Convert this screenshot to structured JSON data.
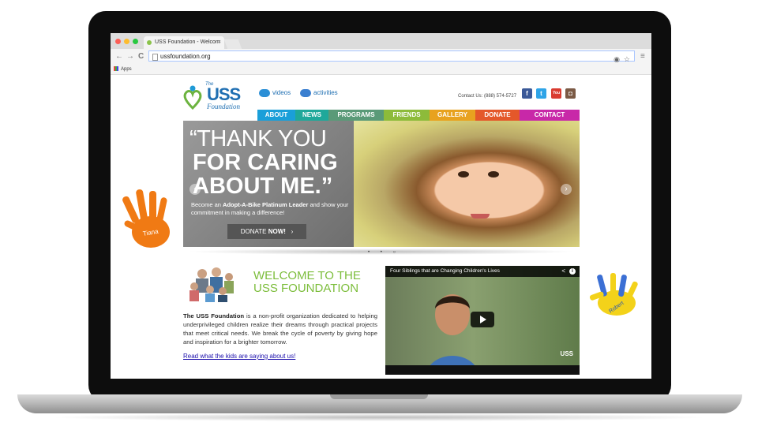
{
  "browser": {
    "tab_title": "USS Foundation - Welcom",
    "tab_close": "×",
    "url": "ussfoundation.org",
    "bookmarks_apps": "Apps",
    "back": "←",
    "forward": "→",
    "reload": "C",
    "menu": "≡"
  },
  "site": {
    "logo_the": "The",
    "logo_uss": "USS",
    "logo_foundation": "Foundation",
    "media_videos": "videos",
    "media_activities": "activities",
    "contact": "Contact Us: (888) 574-5727",
    "social": {
      "facebook": "f",
      "twitter": "t",
      "youtube": "You",
      "instagram": "◘"
    },
    "nav": [
      {
        "label": "ABOUT",
        "color": "#1a9fd9"
      },
      {
        "label": "NEWS",
        "color": "#1fa89a"
      },
      {
        "label": "PROGRAMS",
        "color": "#5a9a78"
      },
      {
        "label": "FRIENDS",
        "color": "#8dbb3a"
      },
      {
        "label": "GALLERY",
        "color": "#e8a21f"
      },
      {
        "label": "DONATE",
        "color": "#e4582a"
      },
      {
        "label": "CONTACT",
        "color": "#c828a8"
      }
    ],
    "hero": {
      "line1": "“THANK YOU",
      "line2": "FOR CARING",
      "line3": "ABOUT ME.”",
      "sub_pre": "Become an ",
      "sub_bold": "Adopt-A-Bike Platinum Leader",
      "sub_post": " and show your commitment in making a difference!",
      "donate_pre": "DONATE ",
      "donate_bold": "NOW!",
      "donate_arrow": "›",
      "prev": "‹",
      "next": "›",
      "dots": "• • ○"
    },
    "welcome": {
      "line1": "WELCOME TO THE",
      "line2": "USS FOUNDATION",
      "desc_bold": "The USS Foundation",
      "desc_rest": " is a non-profit organization dedicated to helping underprivileged children realize their dreams through practical projects that meet critical needs. We break the cycle of poverty by giving hope and inspiration for a brighter tomorrow.",
      "link": "Read what the kids are saying about us!"
    },
    "video": {
      "title": "Four Siblings that are Changing Children's Lives",
      "share": "<",
      "info": "i",
      "logo": "USS"
    },
    "hand_left_name": "Tiana",
    "hand_right_name": "Robert"
  }
}
